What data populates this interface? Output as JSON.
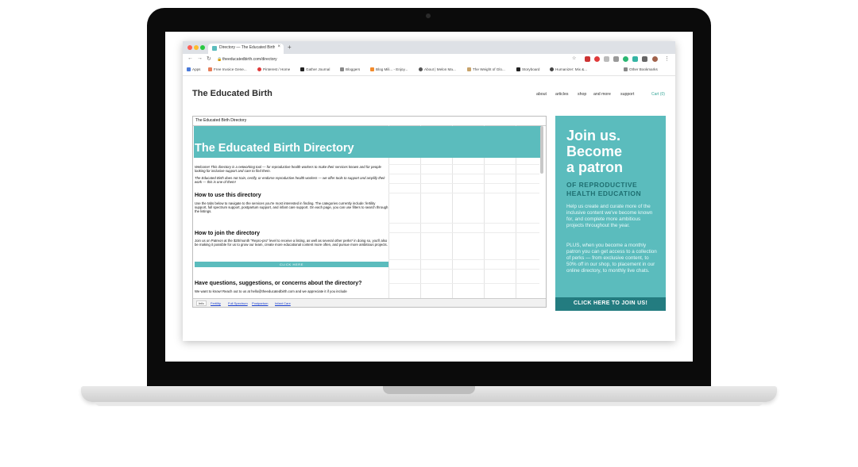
{
  "browser": {
    "tab_title": "Directory — The Educated Birth",
    "tab_close": "×",
    "new_tab": "+",
    "url": "theeducatedbirth.com/directory",
    "bookmarks": [
      "Apps",
      "Free Invoice Gene...",
      "Pinterest / Home",
      "Gather Journal",
      "Bloggers",
      "Blog Mili... - Enjoy...",
      "About | Melon Ma...",
      "The Weight of Glo...",
      "Storyboard",
      "Humanizer: Mix &...",
      "Other Bookmarks"
    ]
  },
  "site": {
    "title": "The Educated Birth",
    "nav": [
      "about",
      "articles",
      "shop",
      "and more",
      "support"
    ],
    "cart": "Cart (0)"
  },
  "sheet": {
    "header": "The Educated Birth Directory",
    "banner_title": "The Educated Birth Directory",
    "welcome_1": "Welcome! This directory is a networking tool — for reproductive health workers to make their services known and for people looking for inclusive support and care to find them.",
    "welcome_2": "The Educated Birth does not train, certify, or endorse reproductive health workers — we offer tools to support and amplify their work — this is one of them!",
    "how_use_heading": "How to use this directory",
    "how_use_text": "Use the tabs below to navigate to the services you're most interested in finding. The categories currently include: fertility support, full spectrum support, postpartum support, and infant care support. On each page, you can use filters to search through the listings.",
    "how_join_heading": "How to join the directory",
    "how_join_text": "Join us on Patreon at the $20/month \"Repro-pro\" level to receive a listing, as well as several other perks* in doing so, you'll also be making it possible for us to grow our team, create more educational content more often, and pursue more ambitious projects.",
    "click_here": "CLICK HERE",
    "questions_heading": "Have questions, suggestions, or concerns about the directory?",
    "questions_text": "We want to know! Reach out to us at hello@theeducatedbirth.com and we appreciate it if you include",
    "tabs": [
      "Info",
      "Fertility",
      "Full Spectrum",
      "Postpartum",
      "Infant Care"
    ]
  },
  "patron": {
    "heading_lines": [
      "Join us.",
      "Become",
      "a patron"
    ],
    "sub_lines": [
      "OF REPRODUCTIVE",
      "HEALTH EDUCATION"
    ],
    "body_1": "Help us create and curate more of the inclusive content we've become known for, and complete more ambitious projects throughout the year.",
    "body_2": "PLUS, when you become a monthly patron you can get access to a collection of perks — from exclusive content, to 50% off in our shop, to placement in our online directory, to monthly live chats.",
    "cta": "CLICK HERE TO JOIN US!"
  },
  "colors": {
    "teal": "#5bbcbd",
    "teal_dark": "#237c80",
    "laptop_body": "#0b0b0b"
  }
}
